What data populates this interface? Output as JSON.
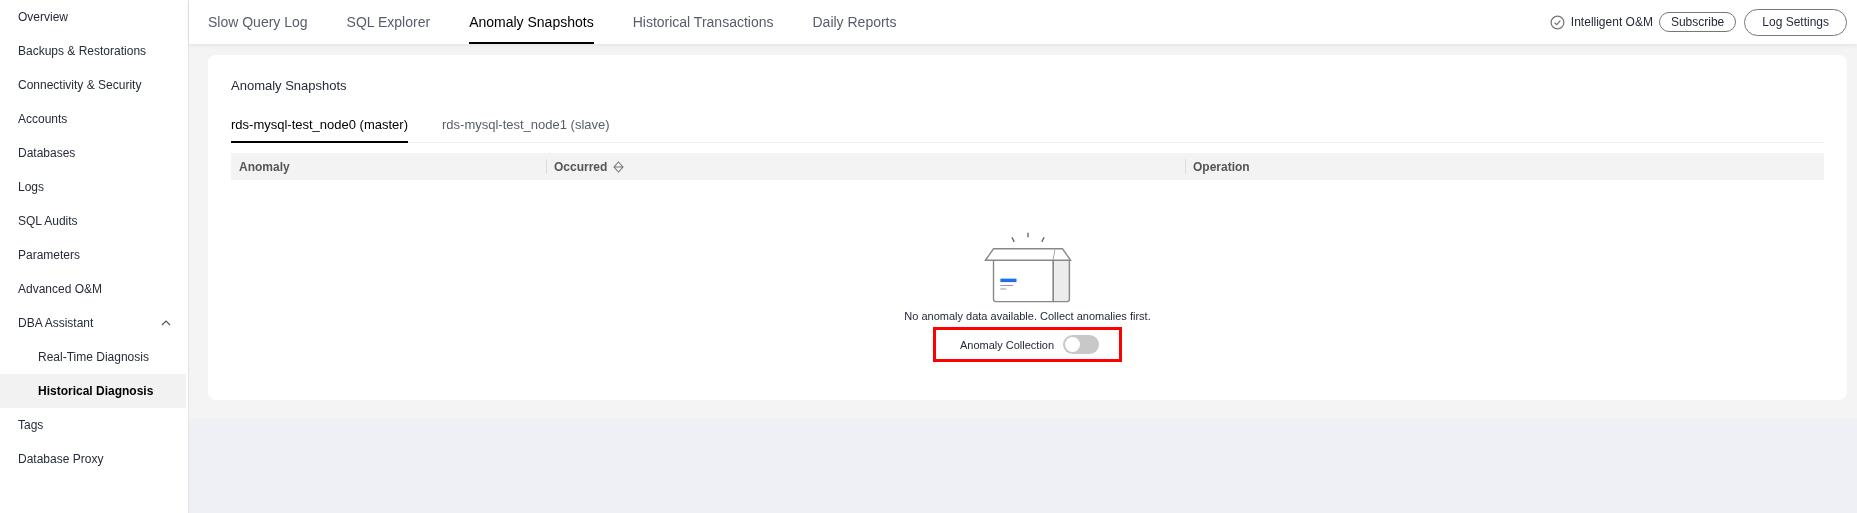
{
  "sidebar": {
    "items": [
      {
        "label": "Overview",
        "selected": false
      },
      {
        "label": "Backups & Restorations",
        "selected": false
      },
      {
        "label": "Connectivity & Security",
        "selected": false
      },
      {
        "label": "Accounts",
        "selected": false
      },
      {
        "label": "Databases",
        "selected": false
      },
      {
        "label": "Logs",
        "selected": false
      },
      {
        "label": "SQL Audits",
        "selected": false
      },
      {
        "label": "Parameters",
        "selected": false
      },
      {
        "label": "Advanced O&M",
        "selected": false
      },
      {
        "label": "DBA Assistant",
        "selected": false,
        "expanded": true,
        "children": [
          {
            "label": "Real-Time Diagnosis",
            "selected": false
          },
          {
            "label": "Historical Diagnosis",
            "selected": true
          }
        ]
      },
      {
        "label": "Tags",
        "selected": false
      },
      {
        "label": "Database Proxy",
        "selected": false
      }
    ]
  },
  "tabs": [
    {
      "label": "Slow Query Log",
      "selected": false
    },
    {
      "label": "SQL Explorer",
      "selected": false
    },
    {
      "label": "Anomaly Snapshots",
      "selected": true
    },
    {
      "label": "Historical Transactions",
      "selected": false
    },
    {
      "label": "Daily Reports",
      "selected": false
    }
  ],
  "toolbar": {
    "intelligent_om": "Intelligent O&M",
    "buttons": [
      {
        "label": "Subscribe",
        "kind": "small"
      },
      {
        "label": "Log Settings",
        "kind": "large"
      }
    ]
  },
  "card": {
    "title": "Anomaly Snapshots",
    "node_tabs": [
      {
        "label": "rds-mysql-test_node0 (master)",
        "selected": true
      },
      {
        "label": "rds-mysql-test_node1 (slave)",
        "selected": false
      }
    ],
    "table": {
      "columns": [
        {
          "label": "Anomaly",
          "sortable": false
        },
        {
          "label": "Occurred",
          "sortable": true
        },
        {
          "label": "Operation",
          "sortable": false
        }
      ]
    },
    "empty": {
      "message": "No anomaly data available. Collect anomalies first.",
      "toggle": {
        "label": "Anomaly Collection",
        "on": false,
        "highlighted": true
      }
    }
  }
}
